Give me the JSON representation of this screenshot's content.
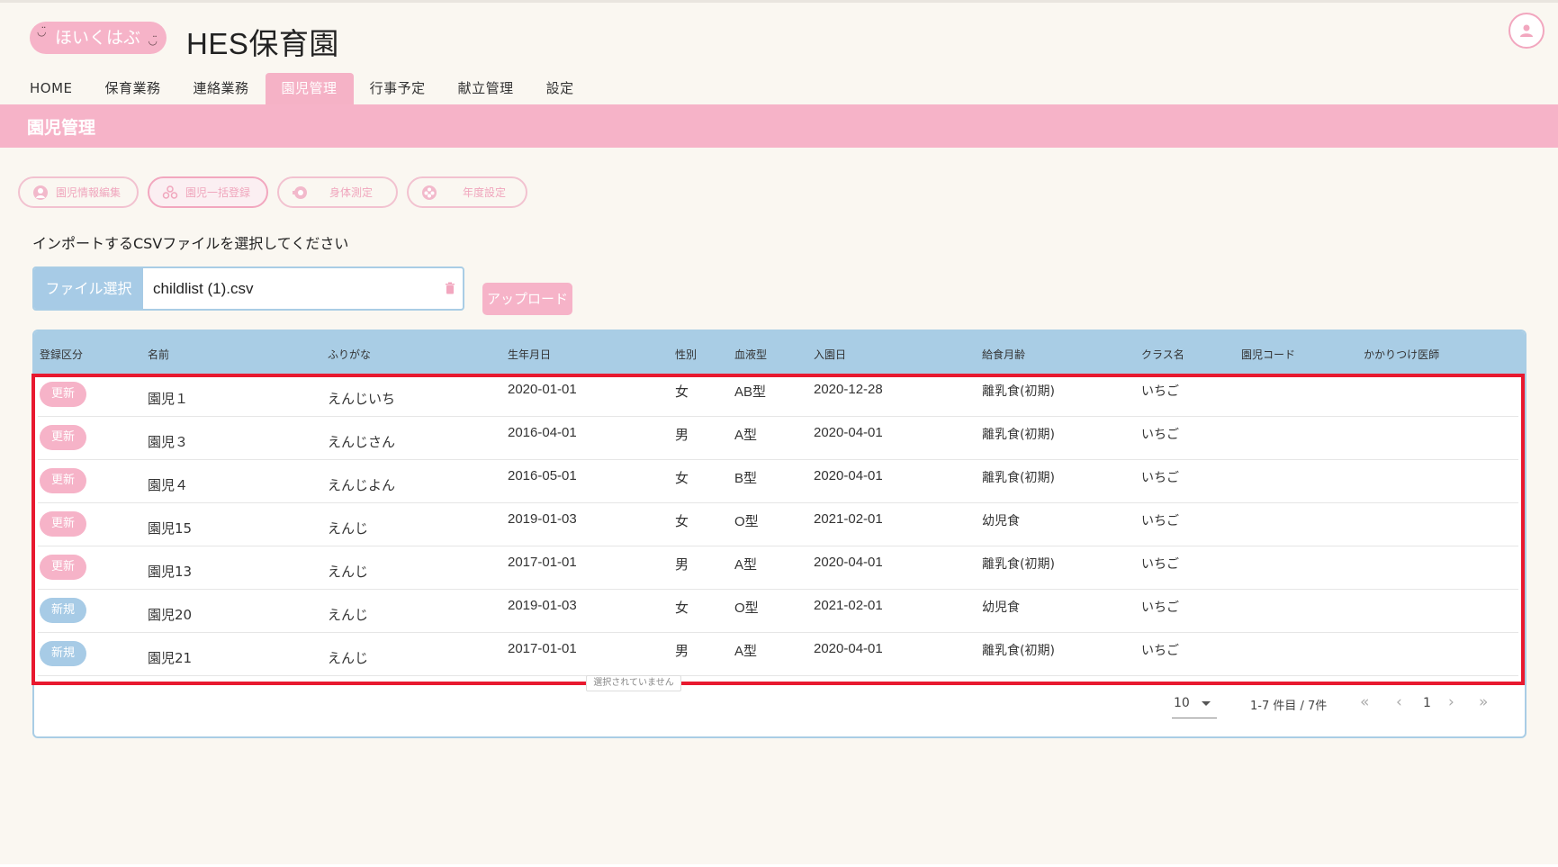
{
  "header": {
    "logo_text": "ほいくはぶ",
    "site_title": "HES保育園"
  },
  "nav": {
    "tabs": [
      {
        "label": "HOME"
      },
      {
        "label": "保育業務"
      },
      {
        "label": "連絡業務"
      },
      {
        "label": "園児管理",
        "active": true
      },
      {
        "label": "行事予定"
      },
      {
        "label": "献立管理"
      },
      {
        "label": "設定"
      }
    ]
  },
  "page": {
    "title": "園児管理",
    "actions": [
      {
        "label": "園児情報編集",
        "icon": "child-icon"
      },
      {
        "label": "園児一括登録",
        "icon": "group-icon",
        "active": true
      },
      {
        "label": "身体測定",
        "icon": "measure-icon"
      },
      {
        "label": "年度設定",
        "icon": "flower-icon"
      }
    ],
    "instruction": "インポートするCSVファイルを選択してください",
    "file_button": "ファイル選択",
    "file_name": "childlist (1).csv",
    "upload_button": "アップロード"
  },
  "table": {
    "headers": [
      "登録区分",
      "名前",
      "ふりがな",
      "生年月日",
      "性別",
      "血液型",
      "入園日",
      "給食月齢",
      "クラス名",
      "園児コード",
      "かかりつけ医師"
    ],
    "rows": [
      {
        "status": "更新",
        "name": "園児１",
        "kana": "えんじいち",
        "birth": "2020-01-01",
        "sex": "女",
        "blood": "AB型",
        "entry": "2020-12-28",
        "meal": "離乳食(初期)",
        "class": "いちご"
      },
      {
        "status": "更新",
        "name": "園児３",
        "kana": "えんじさん",
        "birth": "2016-04-01",
        "sex": "男",
        "blood": "A型",
        "entry": "2020-04-01",
        "meal": "離乳食(初期)",
        "class": "いちご"
      },
      {
        "status": "更新",
        "name": "園児４",
        "kana": "えんじよん",
        "birth": "2016-05-01",
        "sex": "女",
        "blood": "B型",
        "entry": "2020-04-01",
        "meal": "離乳食(初期)",
        "class": "いちご"
      },
      {
        "status": "更新",
        "name": "園児15",
        "kana": "えんじ",
        "birth": "2019-01-03",
        "sex": "女",
        "blood": "O型",
        "entry": "2021-02-01",
        "meal": "幼児食",
        "class": "いちご"
      },
      {
        "status": "更新",
        "name": "園児13",
        "kana": "えんじ",
        "birth": "2017-01-01",
        "sex": "男",
        "blood": "A型",
        "entry": "2020-04-01",
        "meal": "離乳食(初期)",
        "class": "いちご"
      },
      {
        "status": "新規",
        "name": "園児20",
        "kana": "えんじ",
        "birth": "2019-01-03",
        "sex": "女",
        "blood": "O型",
        "entry": "2021-02-01",
        "meal": "幼児食",
        "class": "いちご"
      },
      {
        "status": "新規",
        "name": "園児21",
        "kana": "えんじ",
        "birth": "2017-01-01",
        "sex": "男",
        "blood": "A型",
        "entry": "2020-04-01",
        "meal": "離乳食(初期)",
        "class": "いちご"
      }
    ],
    "tooltip": "選択されていません"
  },
  "pagination": {
    "per_page": "10",
    "range": "1-7 件目 / 7件",
    "page": "1",
    "first": "«",
    "prev": "‹",
    "next": "›",
    "last": "»"
  },
  "colors": {
    "pink": "#f6b3c8",
    "blue": "#a9cde5",
    "highlight": "#e8192f",
    "background": "#faf7f1"
  }
}
